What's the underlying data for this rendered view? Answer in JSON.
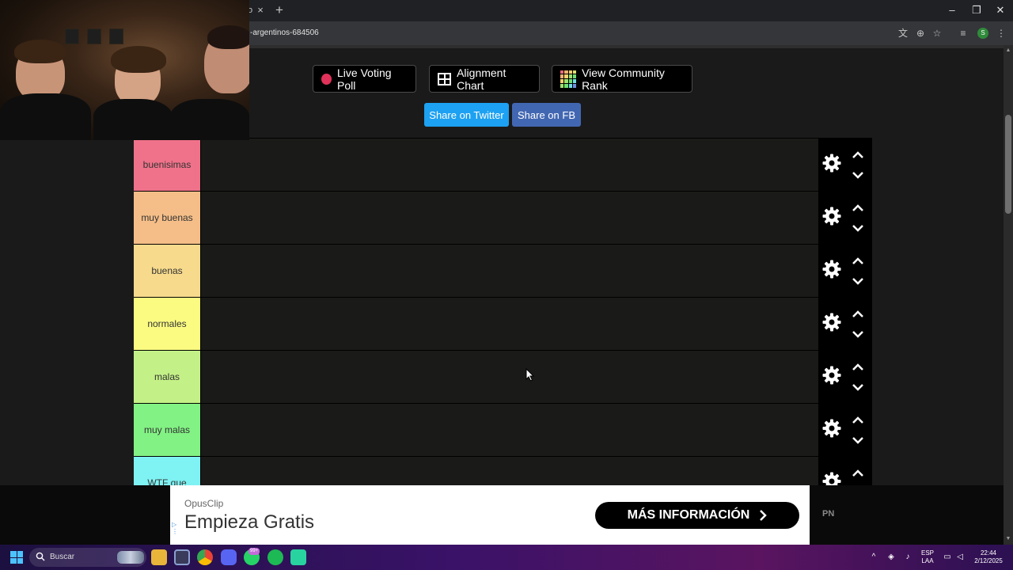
{
  "browser": {
    "tab_close": "×",
    "tab_partial": "o",
    "new_tab": "+",
    "url": "-argentinos-684506",
    "window": {
      "minimize": "–",
      "restore": "❐",
      "close": "✕"
    },
    "profile_initial": "S"
  },
  "header": {
    "live_voting_label": "Live Voting Poll",
    "alignment_label": "Alignment Chart",
    "community_label": "View Community Rank",
    "share_twitter": "Share on Twitter",
    "share_fb": "Share on FB"
  },
  "tiers": [
    {
      "label": "buenisimas",
      "color": "#f0728a"
    },
    {
      "label": "muy buenas",
      "color": "#f5be88"
    },
    {
      "label": "buenas",
      "color": "#f7da8c"
    },
    {
      "label": "normales",
      "color": "#fbfb82"
    },
    {
      "label": "malas",
      "color": "#c4f187"
    },
    {
      "label": "muy malas",
      "color": "#82f284"
    },
    {
      "label": "WTF que",
      "color": "#7ff2f3"
    }
  ],
  "ad": {
    "brand": "OpusClip",
    "headline": "Empieza Gratis",
    "cta": "MÁS INFORMACIÓN",
    "side_label": "PN"
  },
  "taskbar": {
    "search_placeholder": "Buscar",
    "badge": "99+",
    "lang_top": "ESP",
    "lang_bottom": "LAA",
    "time": "22:44",
    "date": "2/12/2025"
  },
  "colors": {
    "twitter_blue": "#1da1f2",
    "fb_blue": "#4267b2",
    "live_dot": "#e0325a"
  }
}
